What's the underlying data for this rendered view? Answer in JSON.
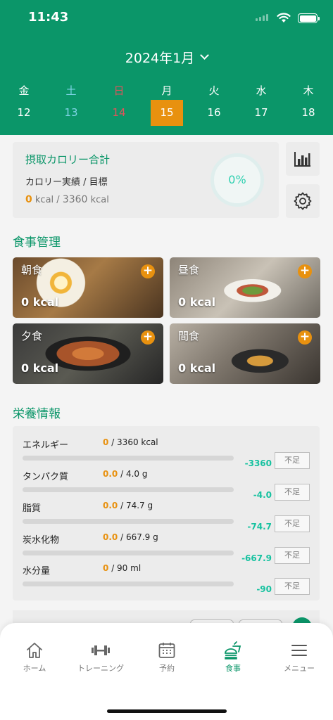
{
  "status_bar": {
    "time": "11:43"
  },
  "calendar": {
    "month_label": "2024年1月",
    "days": [
      {
        "dow": "金",
        "num": "12",
        "kind": "weekday"
      },
      {
        "dow": "土",
        "num": "13",
        "kind": "sat"
      },
      {
        "dow": "日",
        "num": "14",
        "kind": "sun"
      },
      {
        "dow": "月",
        "num": "15",
        "kind": "selected"
      },
      {
        "dow": "火",
        "num": "16",
        "kind": "weekday"
      },
      {
        "dow": "水",
        "num": "17",
        "kind": "weekday"
      },
      {
        "dow": "木",
        "num": "18",
        "kind": "weekday"
      }
    ]
  },
  "calorie_summary": {
    "title": "摂取カロリー合計",
    "subtitle": "カロリー実績 / 目標",
    "actual": "0",
    "actual_unit": "kcal",
    "target": "3360",
    "target_unit": "kcal",
    "percent": "0%"
  },
  "side_buttons": {
    "chart_icon": "bar-chart-icon",
    "settings_icon": "gear-icon"
  },
  "meal_section": {
    "title": "食事管理",
    "meals": [
      {
        "name": "朝食",
        "kcal": "0 kcal",
        "plus": "+"
      },
      {
        "name": "昼食",
        "kcal": "0 kcal",
        "plus": "+"
      },
      {
        "name": "夕食",
        "kcal": "0 kcal",
        "plus": "+"
      },
      {
        "name": "間食",
        "kcal": "0 kcal",
        "plus": "+"
      }
    ]
  },
  "nutrition": {
    "title": "栄養情報",
    "items": [
      {
        "label": "エネルギー",
        "actual": "0",
        "target": "/ 3360 kcal",
        "diff": "-3360",
        "status": "不足",
        "progress": 0
      },
      {
        "label": "タンパク質",
        "actual": "0.0",
        "target": "/ 4.0 g",
        "diff": "-4.0",
        "status": "不足",
        "progress": 0
      },
      {
        "label": "脂質",
        "actual": "0.0",
        "target": "/ 74.7 g",
        "diff": "-74.7",
        "status": "不足",
        "progress": 0
      },
      {
        "label": "炭水化物",
        "actual": "0.0",
        "target": "/ 667.9 g",
        "diff": "-667.9",
        "status": "不足",
        "progress": 0
      },
      {
        "label": "水分量",
        "actual": "0",
        "target": "/ 90 ml",
        "diff": "-90",
        "status": "不足",
        "progress": 0
      }
    ]
  },
  "tab_bar": {
    "tabs": [
      {
        "label": "ホーム",
        "icon": "house-icon",
        "active": false
      },
      {
        "label": "トレーニング",
        "icon": "dumbbell-icon",
        "active": false
      },
      {
        "label": "予約",
        "icon": "calendar-icon",
        "active": false
      },
      {
        "label": "食事",
        "icon": "burger-drink-icon",
        "active": true
      },
      {
        "label": "メニュー",
        "icon": "menu-icon",
        "active": false
      }
    ]
  },
  "colors": {
    "brand_green": "#0b9669",
    "accent_orange": "#e8910f",
    "teal_text": "#17c2a0",
    "sunday_red": "#e0545a",
    "saturday_blue": "#7fd4e6"
  }
}
